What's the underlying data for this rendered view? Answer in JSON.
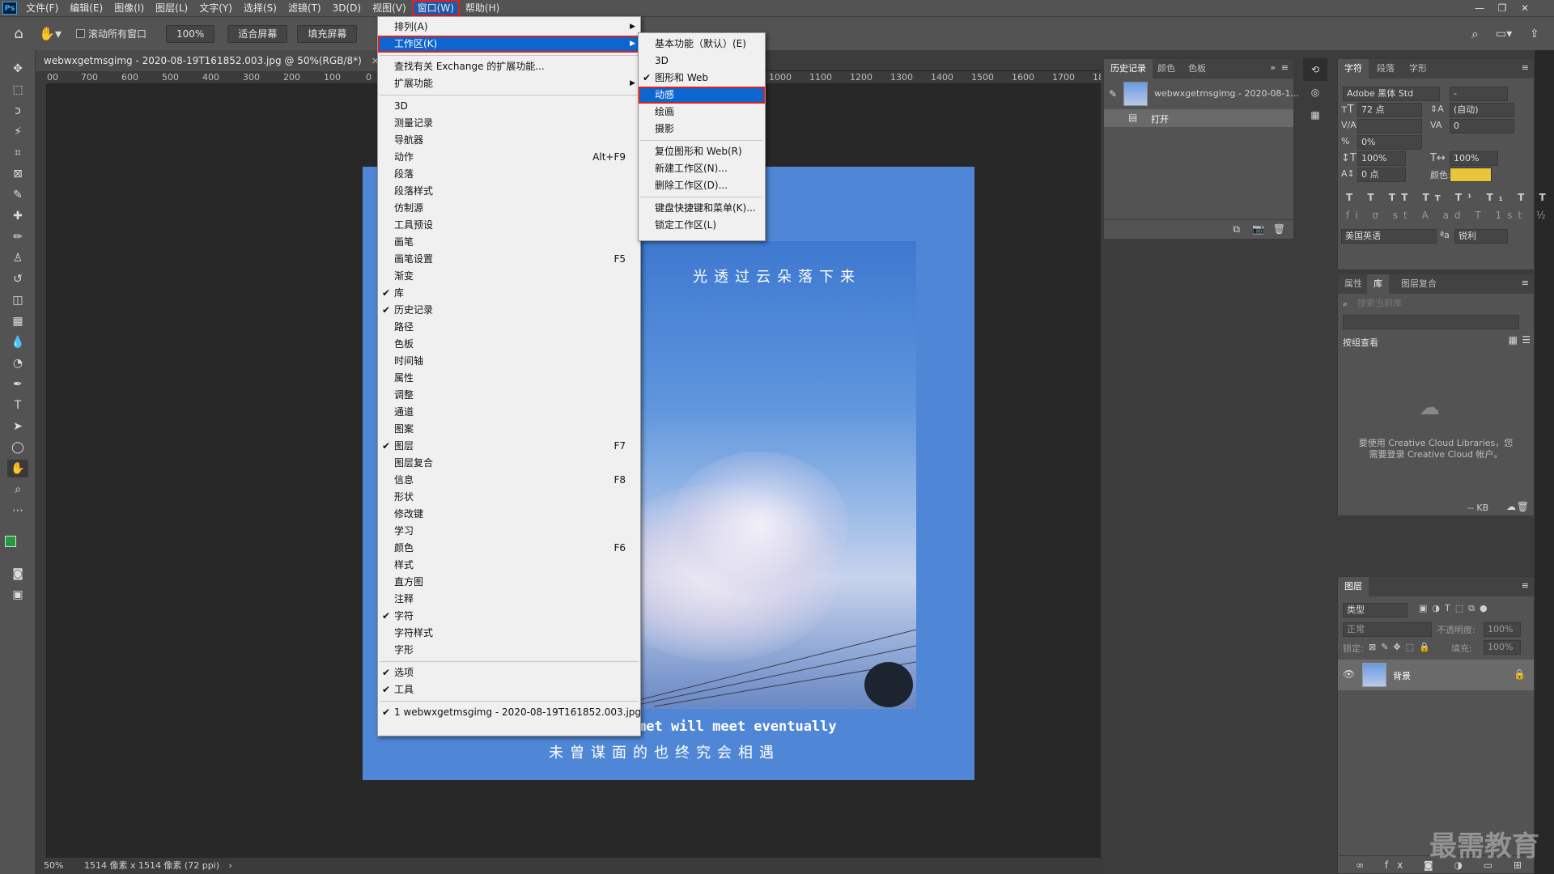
{
  "app": {
    "logo": "Ps"
  },
  "menubar": {
    "items": [
      "文件(F)",
      "编辑(E)",
      "图像(I)",
      "图层(L)",
      "文字(Y)",
      "选择(S)",
      "滤镜(T)",
      "3D(D)",
      "视图(V)",
      "窗口(W)",
      "帮助(H)"
    ],
    "active_index": 9
  },
  "window_controls": {
    "minimize": "—",
    "restore": "❐",
    "close": "✕"
  },
  "options": {
    "scroll_all_windows_label": "滚动所有窗口",
    "zoom_value": "100%",
    "fit_screen_label": "适合屏幕",
    "fill_screen_label": "填充屏幕"
  },
  "document_tab": {
    "title": "webwxgetmsgimg - 2020-08-19T161852.003.jpg @ 50%(RGB/8*)",
    "close": "×"
  },
  "ruler": {
    "left_ticks": [
      "00",
      "700",
      "600",
      "500",
      "400",
      "300",
      "200",
      "100",
      "0"
    ],
    "right_ticks": [
      "1000",
      "1100",
      "1200",
      "1300",
      "1400",
      "1500",
      "1600",
      "1700",
      "18"
    ]
  },
  "canvas": {
    "tagline_cn": "光透过云朵落下来",
    "tagline_en": "met will meet eventually",
    "subtitle_cn": "未曾谋面的也终究会相遇",
    "background_color": "#4f87d6"
  },
  "window_menu": {
    "items": [
      {
        "label": "排列(A)",
        "submenu": true
      },
      {
        "label": "工作区(K)",
        "submenu": true,
        "highlighted": true
      },
      {
        "sep": true
      },
      {
        "label": "查找有关 Exchange 的扩展功能..."
      },
      {
        "label": "扩展功能",
        "submenu": true
      },
      {
        "sep": true
      },
      {
        "label": "3D"
      },
      {
        "label": "测量记录"
      },
      {
        "label": "导航器"
      },
      {
        "label": "动作",
        "shortcut": "Alt+F9"
      },
      {
        "label": "段落"
      },
      {
        "label": "段落样式"
      },
      {
        "label": "仿制源"
      },
      {
        "label": "工具预设"
      },
      {
        "label": "画笔"
      },
      {
        "label": "画笔设置",
        "shortcut": "F5"
      },
      {
        "label": "渐变"
      },
      {
        "label": "库",
        "checked": true
      },
      {
        "label": "历史记录",
        "checked": true
      },
      {
        "label": "路径"
      },
      {
        "label": "色板"
      },
      {
        "label": "时间轴"
      },
      {
        "label": "属性"
      },
      {
        "label": "调整"
      },
      {
        "label": "通道"
      },
      {
        "label": "图案"
      },
      {
        "label": "图层",
        "checked": true,
        "shortcut": "F7"
      },
      {
        "label": "图层复合"
      },
      {
        "label": "信息",
        "shortcut": "F8"
      },
      {
        "label": "形状"
      },
      {
        "label": "修改键"
      },
      {
        "label": "学习"
      },
      {
        "label": "颜色",
        "shortcut": "F6"
      },
      {
        "label": "样式"
      },
      {
        "label": "直方图"
      },
      {
        "label": "注释"
      },
      {
        "label": "字符",
        "checked": true
      },
      {
        "label": "字符样式"
      },
      {
        "label": "字形"
      },
      {
        "sep": true
      },
      {
        "label": "选项",
        "checked": true
      },
      {
        "label": "工具",
        "checked": true
      },
      {
        "sep": true
      },
      {
        "label": "1 webwxgetmsgimg - 2020-08-19T161852.003.jpg",
        "checked": true
      }
    ]
  },
  "workspace_submenu": {
    "items": [
      {
        "label": "基本功能（默认）(E)"
      },
      {
        "label": "3D"
      },
      {
        "label": "图形和 Web",
        "checked": true
      },
      {
        "label": "动感",
        "highlighted": true
      },
      {
        "label": "绘画"
      },
      {
        "label": "摄影"
      },
      {
        "sep": true
      },
      {
        "label": "复位图形和 Web(R)"
      },
      {
        "label": "新建工作区(N)..."
      },
      {
        "label": "删除工作区(D)..."
      },
      {
        "sep": true
      },
      {
        "label": "键盘快捷键和菜单(K)..."
      },
      {
        "label": "锁定工作区(L)"
      }
    ]
  },
  "history_panel": {
    "tabs": [
      "历史记录",
      "颜色",
      "色板"
    ],
    "snapshot_label": "webwxgetmsgimg - 2020-08-1...",
    "step_label": "打开"
  },
  "character_panel": {
    "tabs": [
      "字符",
      "段落",
      "字形"
    ],
    "font_family": "Adobe 黑体 Std",
    "font_style": "-",
    "font_size": "72 点",
    "leading": "(自动)",
    "kerning": "",
    "tracking": "0",
    "tsume": "0%",
    "vertical_scale": "100%",
    "horizontal_scale": "100%",
    "baseline_shift": "0 点",
    "color_label": "颜色:",
    "color_value": "#e8c53a",
    "language": "美国英语",
    "antialias": "锐利"
  },
  "libraries_panel": {
    "tabs": [
      "属性",
      "库",
      "图层复合"
    ],
    "search_placeholder": "搜索当前库",
    "group_by": "按组查看",
    "message_line1": "要使用 Creative Cloud Libraries，您",
    "message_line2": "需要登录 Creative Cloud 帐户。",
    "size": "-- KB"
  },
  "layers_panel": {
    "title": "图层",
    "filter_label": "类型",
    "blend_mode": "正常",
    "opacity_label": "不透明度:",
    "opacity_value": "100%",
    "lock_label": "锁定:",
    "fill_label": "填充:",
    "fill_value": "100%",
    "layer_name": "背景"
  },
  "status": {
    "zoom": "50%",
    "doc_info": "1514 像素 x 1514 像素 (72 ppi)"
  },
  "watermark": "最需教育"
}
